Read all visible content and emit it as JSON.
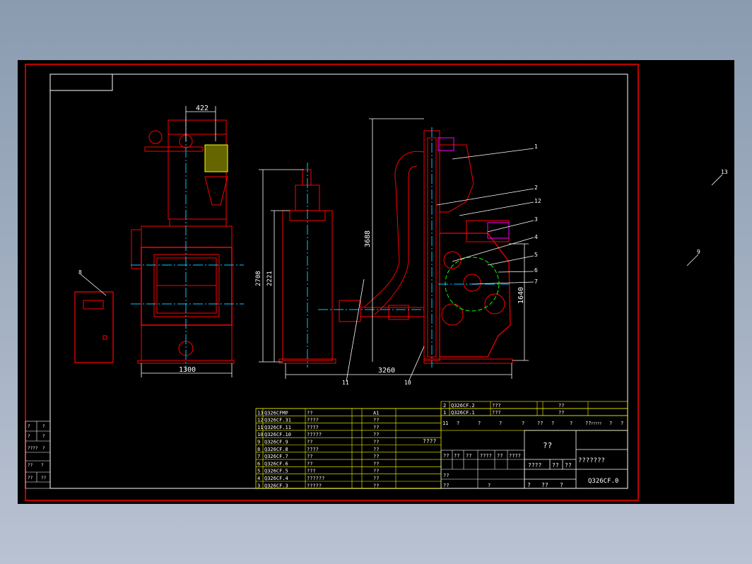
{
  "colors": {
    "background": "#000000",
    "frame": "#ff0000",
    "inner_border": "#ffffff",
    "title_table": "#ffff00",
    "dimension": "#ffffff",
    "centerline": "#00c8ff",
    "cage": "#00ff00",
    "motor": "#ff00ff"
  },
  "dimensions": {
    "top_width": "422",
    "front_width": "1300",
    "collector_height_outer": "2708",
    "collector_height_inner": "2221",
    "side_height": "3688",
    "side_width": "3260",
    "chamber_height": "1640"
  },
  "leader_labels": [
    "1",
    "2",
    "12",
    "3",
    "4",
    "5",
    "6",
    "7",
    "8",
    "11",
    "10",
    "13",
    "9"
  ],
  "parts_list": [
    {
      "no": "13",
      "code": "Q326CFMP",
      "name": "??",
      "qty": "",
      "mat": "A1"
    },
    {
      "no": "12",
      "code": "Q326CF.31",
      "name": "????",
      "qty": "",
      "mat": "??"
    },
    {
      "no": "11",
      "code": "Q326CF.11",
      "name": "????",
      "qty": "",
      "mat": "??"
    },
    {
      "no": "10",
      "code": "Q326CF.10",
      "name": "?????",
      "qty": "",
      "mat": "??"
    },
    {
      "no": "9",
      "code": "Q326CF.9",
      "name": "??",
      "qty": "",
      "mat": "??"
    },
    {
      "no": "8",
      "code": "Q326CF.8",
      "name": "????",
      "qty": "",
      "mat": "??"
    },
    {
      "no": "7",
      "code": "Q326CF.7",
      "name": "??",
      "qty": "",
      "mat": "??"
    },
    {
      "no": "6",
      "code": "Q326CF.6",
      "name": "??",
      "qty": "",
      "mat": "??"
    },
    {
      "no": "5",
      "code": "Q326CF.5",
      "name": "???",
      "qty": "",
      "mat": "??"
    },
    {
      "no": "4",
      "code": "Q326CF.4",
      "name": "??????",
      "qty": "",
      "mat": "??"
    },
    {
      "no": "3",
      "code": "Q326CF.3",
      "name": "?????",
      "qty": "",
      "mat": "??"
    }
  ],
  "upper_parts": [
    {
      "no": "2",
      "code": "Q326CF.2",
      "name": "???",
      "mat": "??"
    },
    {
      "no": "1",
      "code": "Q326CF.1",
      "name": "???",
      "mat": "??"
    }
  ],
  "header_row": [
    "11",
    "?",
    "?",
    "?",
    "?",
    "??",
    "?",
    "?",
    "??",
    "?????",
    "?",
    "?"
  ],
  "extra_note": "????",
  "title_block": {
    "name": "??",
    "subtitle": "???????",
    "drawing_no": "Q326CF.0",
    "grid_row1": [
      "??",
      "??",
      "??",
      "????",
      "??",
      "????"
    ],
    "grid_row2": [
      "??"
    ],
    "grid_row3": [
      "??",
      "?"
    ],
    "scale_row": [
      "????",
      "??",
      "??"
    ],
    "sheet_row": [
      "?",
      "??",
      "?"
    ]
  },
  "left_stamp": [
    "?",
    "?",
    "?",
    "?",
    "????",
    "?",
    "??",
    "?",
    "??",
    "??"
  ]
}
